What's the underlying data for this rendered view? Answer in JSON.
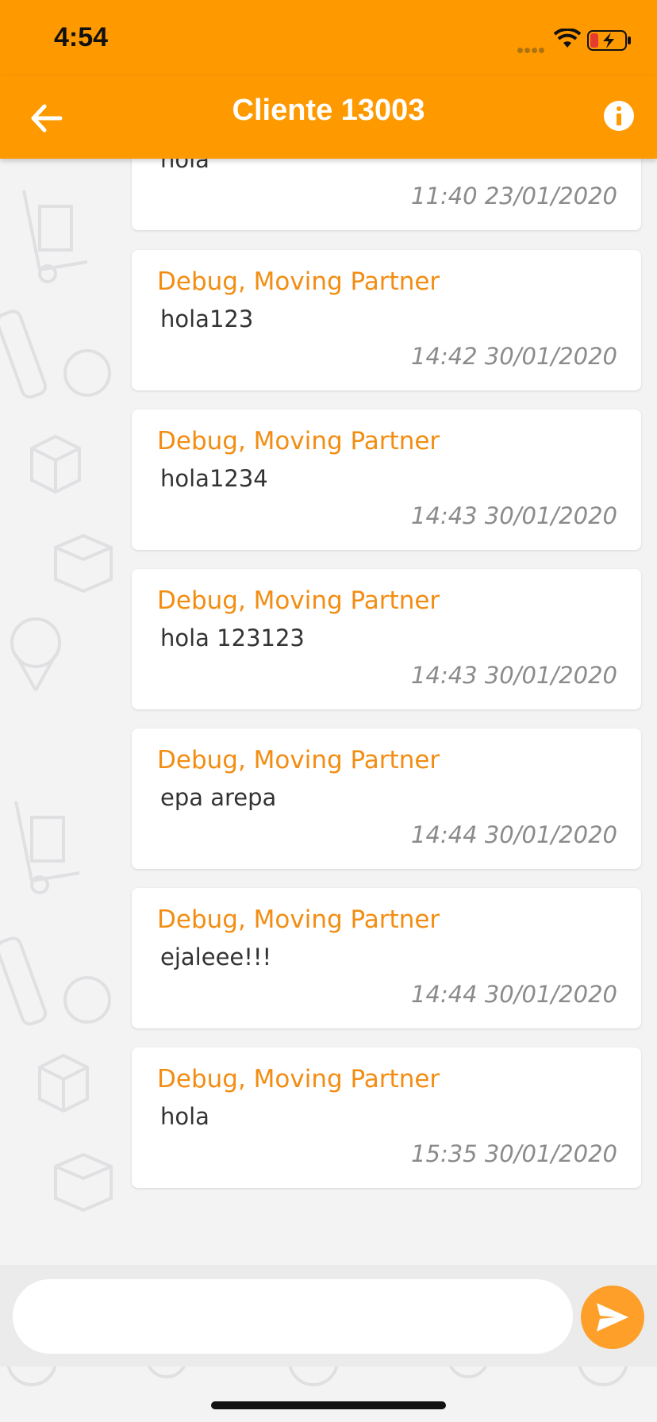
{
  "status_bar": {
    "time": "4:54"
  },
  "header": {
    "title": "Cliente 13003"
  },
  "messages": [
    {
      "sender": "",
      "text": "hola",
      "timestamp": "11:40 23/01/2020"
    },
    {
      "sender": "Debug, Moving Partner",
      "text": "hola123",
      "timestamp": "14:42 30/01/2020"
    },
    {
      "sender": "Debug, Moving Partner",
      "text": "hola1234",
      "timestamp": "14:43 30/01/2020"
    },
    {
      "sender": "Debug, Moving Partner",
      "text": "hola 123123",
      "timestamp": "14:43 30/01/2020"
    },
    {
      "sender": "Debug, Moving Partner",
      "text": "epa arepa",
      "timestamp": "14:44 30/01/2020"
    },
    {
      "sender": "Debug, Moving Partner",
      "text": "ejaleee!!!",
      "timestamp": "14:44 30/01/2020"
    },
    {
      "sender": "Debug, Moving Partner",
      "text": "hola",
      "timestamp": "15:35 30/01/2020"
    }
  ],
  "composer": {
    "value": "",
    "placeholder": ""
  },
  "icons": {
    "back": "arrow-left-icon",
    "info": "info-icon",
    "send": "send-icon"
  },
  "colors": {
    "accent": "#fe9900",
    "sender_text": "#f28d12",
    "timestamp": "#8b8b8b"
  }
}
